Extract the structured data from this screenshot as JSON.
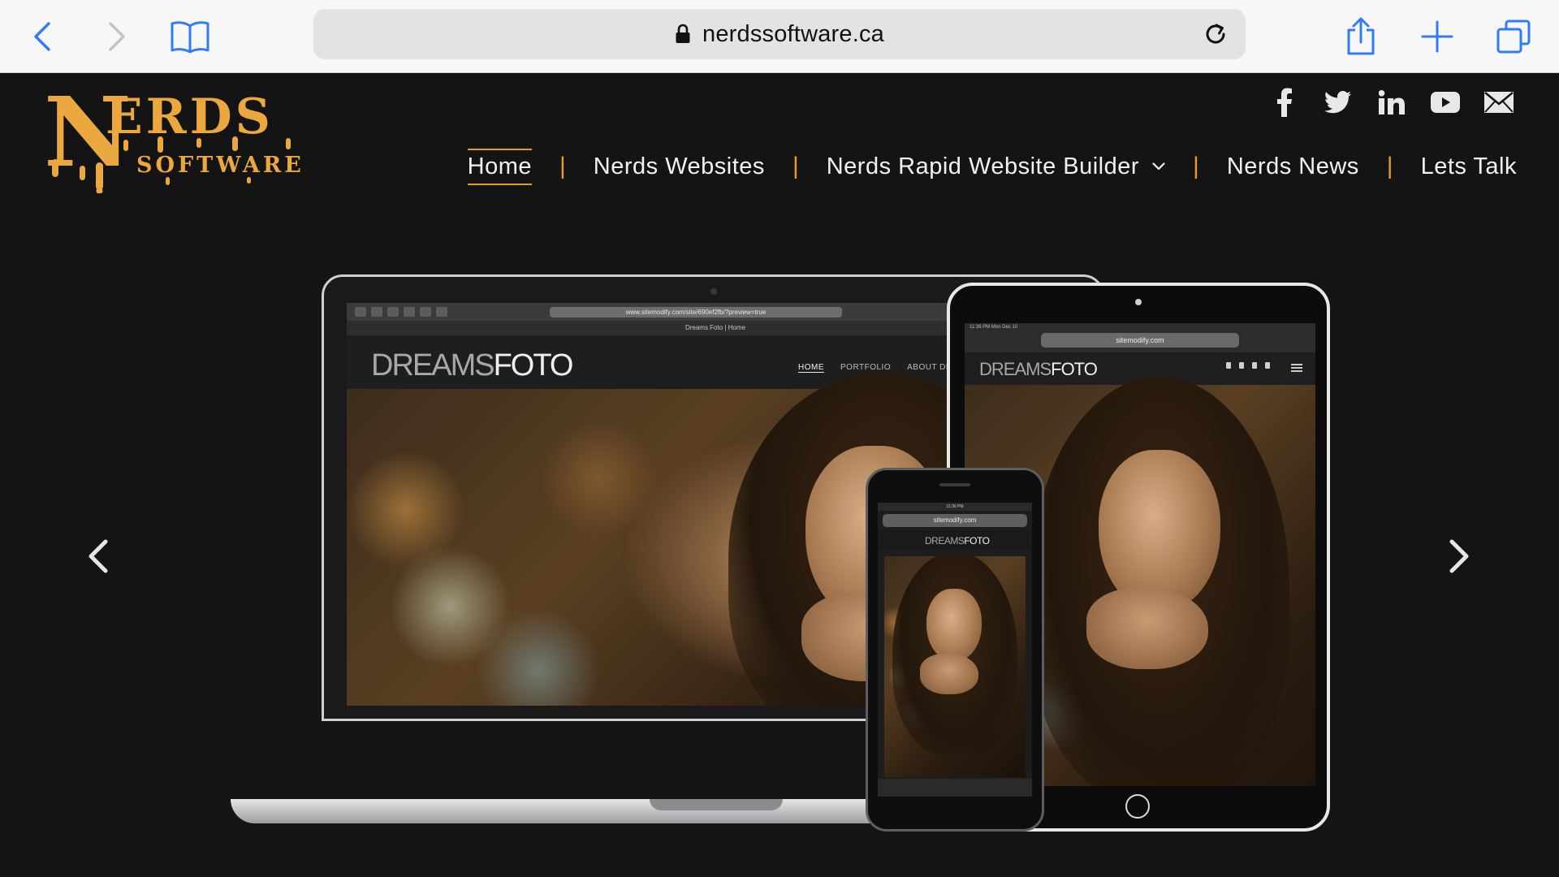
{
  "browser": {
    "url": "nerdssoftware.ca",
    "icons": {
      "back": "chevron-left-icon",
      "forward": "chevron-right-icon",
      "bookmarks": "book-icon",
      "lock": "lock-icon",
      "reload": "reload-icon",
      "share": "share-icon",
      "new_tab": "plus-icon",
      "tabs": "tabs-icon"
    },
    "accent_color": "#2f7cf6"
  },
  "site": {
    "logo": {
      "big": "ERDS",
      "initial": "N",
      "sub": "SOFTWARE",
      "color": "#eaa83e"
    },
    "social": [
      "facebook-icon",
      "twitter-icon",
      "linkedin-icon",
      "youtube-icon",
      "mail-icon"
    ],
    "nav": {
      "items": [
        {
          "label": "Home",
          "active": true
        },
        {
          "label": "Nerds Websites"
        },
        {
          "label": "Nerds Rapid Website Builder",
          "has_dropdown": true
        },
        {
          "label": "Nerds News"
        },
        {
          "label": "Lets Talk"
        }
      ],
      "separator": "|",
      "accent_color": "#e59a2b"
    }
  },
  "slide": {
    "laptop": {
      "url": "www.sitemodify.com/site/690ef2fb/?preview=true",
      "tab_title": "Dreams Foto | Home",
      "logo_thin": "DREAMS",
      "logo_bold": "FOTO",
      "nav": [
        "HOME",
        "PORTFOLIO",
        "ABOUT DREA"
      ]
    },
    "tablet": {
      "status": "11:36 PM  Mon Dec 10",
      "url": "sitemodify.com",
      "logo_thin": "DREAMS",
      "logo_bold": "FOTO"
    },
    "phone": {
      "status": "11:36 PM",
      "url": "sitemodify.com",
      "logo_thin": "DREAMS",
      "logo_bold": "FOTO"
    }
  }
}
